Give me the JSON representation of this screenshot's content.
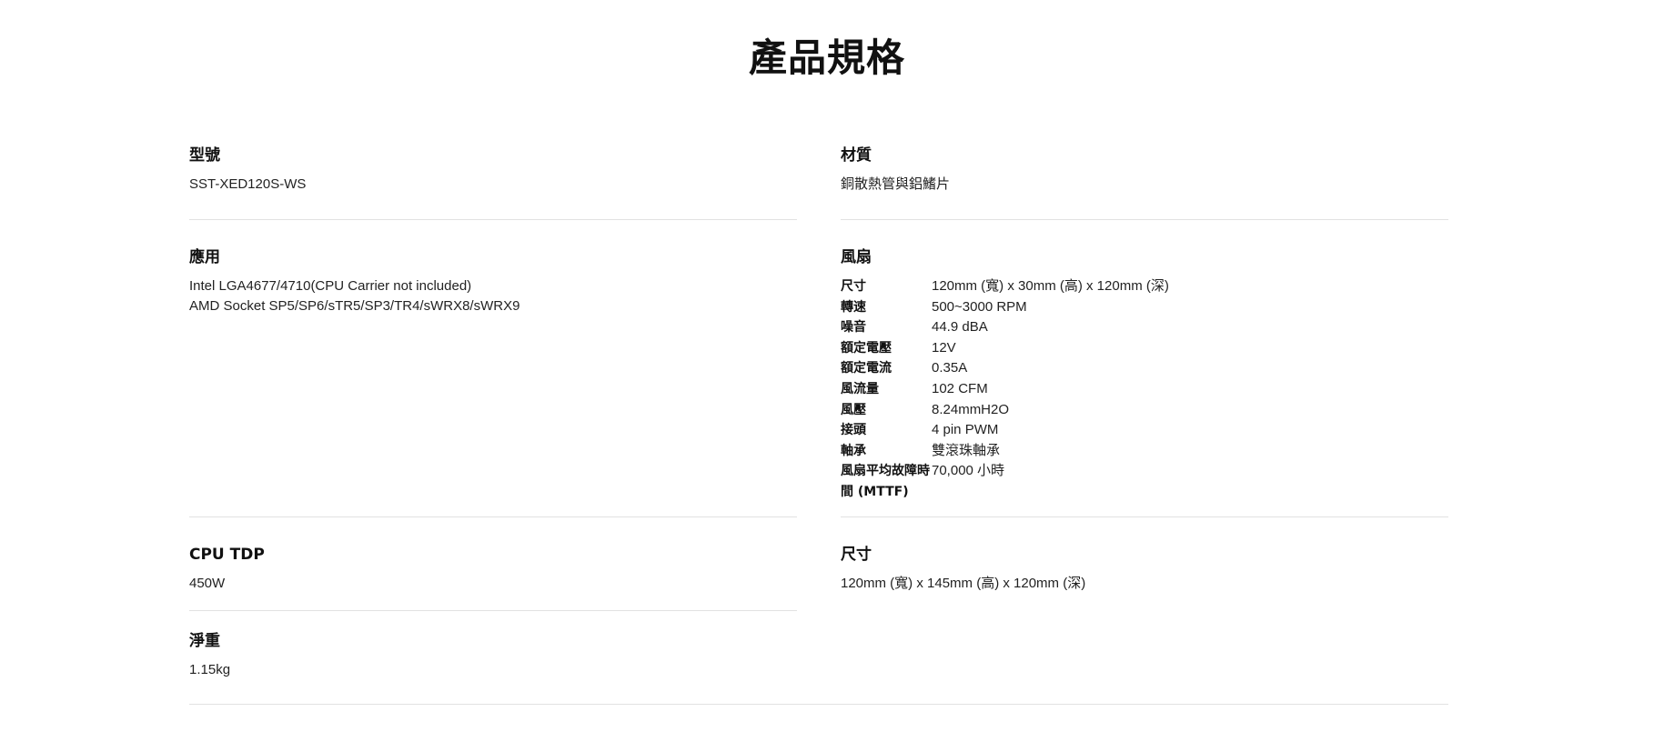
{
  "page": {
    "title": "產品規格"
  },
  "specs": {
    "model": {
      "label": "型號",
      "value": "SST-XED120S-WS"
    },
    "material": {
      "label": "材質",
      "value": "銅散熱管與鋁鰭片"
    },
    "application": {
      "label": "應用",
      "lines": [
        "Intel LGA4677/4710(CPU Carrier not included)",
        "AMD Socket SP5/SP6/sTR5/SP3/TR4/sWRX8/sWRX9"
      ]
    },
    "fan": {
      "label": "風扇",
      "rows": [
        {
          "key": "尺寸",
          "value": "120mm (寬) x 30mm (高) x 120mm (深)"
        },
        {
          "key": "轉速",
          "value": "500~3000 RPM"
        },
        {
          "key": "噪音",
          "value": "44.9 dBA"
        },
        {
          "key": "額定電壓",
          "value": "12V"
        },
        {
          "key": "額定電流",
          "value": "0.35A"
        },
        {
          "key": "風流量",
          "value": "102 CFM"
        },
        {
          "key": "風壓",
          "value": "8.24mmH2O"
        },
        {
          "key": "接頭",
          "value": "4 pin PWM"
        },
        {
          "key": "軸承",
          "value": "雙滾珠軸承"
        },
        {
          "key": "風扇平均故障時間 (MTTF)",
          "value": "70,000 小時"
        }
      ]
    },
    "cpu_tdp": {
      "label": "CPU TDP",
      "value": "450W"
    },
    "dimensions": {
      "label": "尺寸",
      "value": "120mm (寬) x 145mm (高) x 120mm (深)"
    },
    "net_weight": {
      "label": "淨重",
      "value": "1.15kg"
    }
  }
}
